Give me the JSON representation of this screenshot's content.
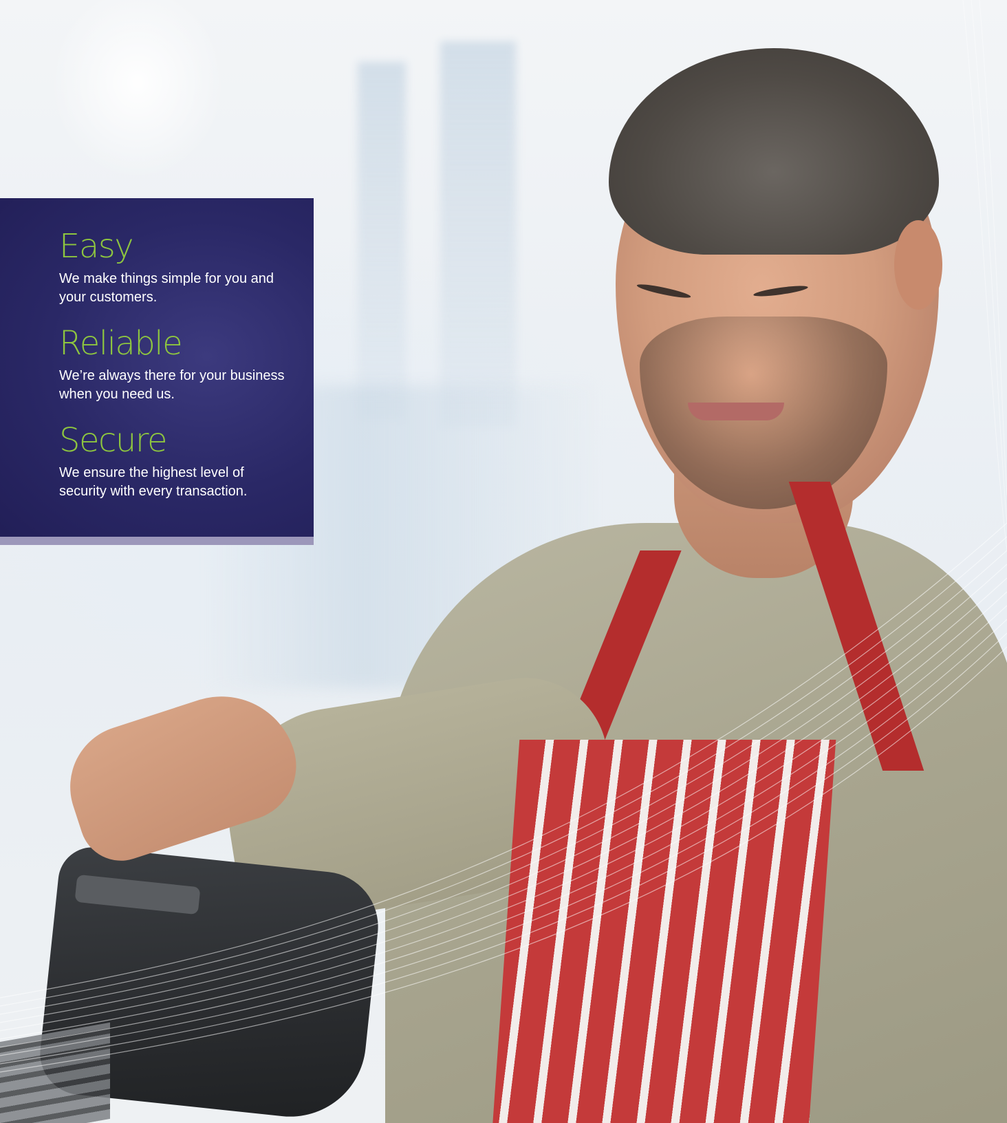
{
  "panel": {
    "accent_color": "#8ec63f",
    "background_color": "#262362",
    "items": [
      {
        "title": "Easy",
        "description": "We make things simple for you and your customers."
      },
      {
        "title": "Reliable",
        "description": "We’re always there for your business when you need us."
      },
      {
        "title": "Secure",
        "description": "We ensure the highest level of security with every transaction."
      }
    ]
  }
}
